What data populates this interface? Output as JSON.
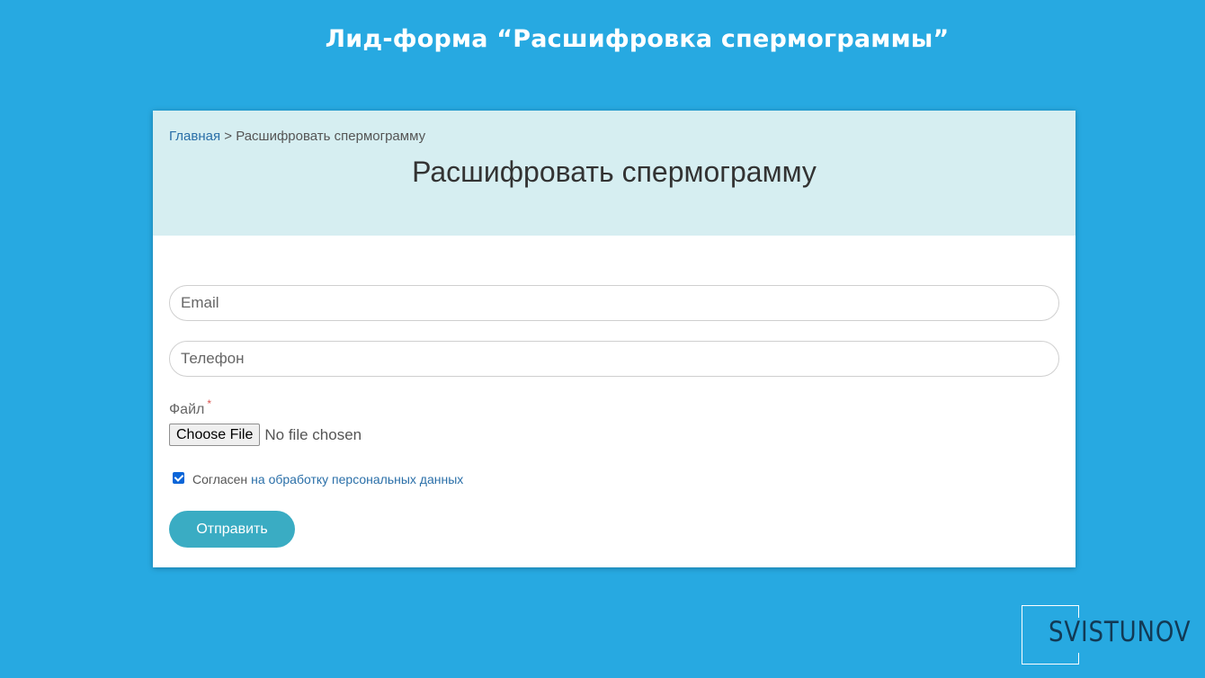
{
  "slide": {
    "title": "Лид-форма “Расшифровка спермограммы”"
  },
  "breadcrumb": {
    "home_label": "Главная",
    "separator": ">",
    "current_label": "Расшифровать спермограмму"
  },
  "page": {
    "title": "Расшифровать спермограмму"
  },
  "form": {
    "email_placeholder": "Email",
    "phone_placeholder": "Телефон",
    "file_label": "Файл",
    "required_mark": "*",
    "file_button_label": "Choose File",
    "file_status": "No file chosen",
    "consent_checked": true,
    "consent_text": "Согласен",
    "consent_link_text": "на обработку персональных данных",
    "submit_label": "Отправить"
  },
  "logo": {
    "text": "SVISTUNOV"
  },
  "colors": {
    "background": "#27a9e1",
    "header_bg": "#d6eef1",
    "link": "#2a6fa8",
    "submit_bg": "#3aacc3",
    "checkbox": "#0b65d8",
    "logo_text": "#123a55"
  }
}
